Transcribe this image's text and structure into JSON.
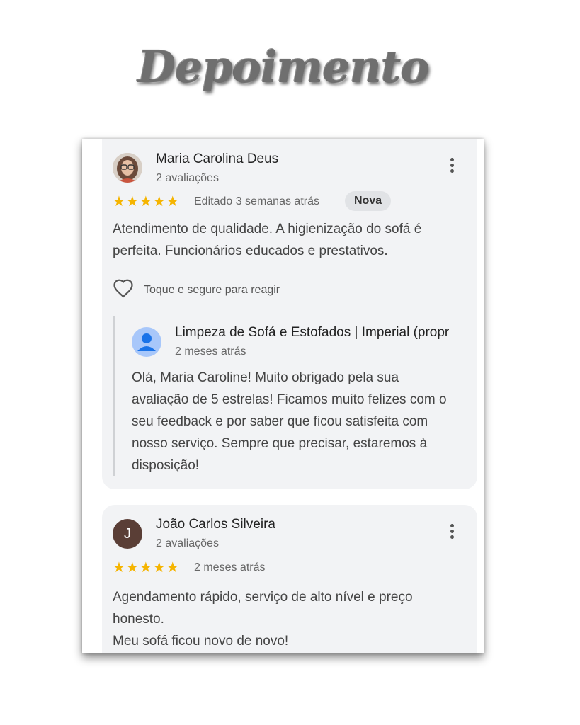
{
  "header": {
    "title": "Depoimento"
  },
  "reviews": [
    {
      "reviewer": "Maria Carolina Deus",
      "review_count": "2 avaliações",
      "stars": "★★★★★",
      "rating": 5,
      "date": "Editado 3 semanas atrás",
      "badge": "Nova",
      "text": "Atendimento de qualidade. A higienização do sofá é perfeita. Funcionários educados e prestativos.",
      "react_label": "Toque e segure para reagir",
      "reply": {
        "owner": "Limpeza de Sofá e Estofados | Imperial (propr",
        "date": "2 meses atrás",
        "text": "Olá, Maria Caroline! Muito obrigado pela sua avaliação de 5 estrelas! Ficamos muito felizes com o seu feedback e por saber que ficou satisfeita com nosso serviço. Sempre que precisar, estaremos à disposição!"
      }
    },
    {
      "reviewer": "João Carlos Silveira",
      "avatar_letter": "J",
      "review_count": "2 avaliações",
      "stars": "★★★★★",
      "rating": 5,
      "date": "2 meses atrás",
      "text_line1": "Agendamento rápido, serviço de alto nível e preço honesto.",
      "text_line2": "Meu sofá ficou novo de novo!"
    }
  ],
  "colors": {
    "star": "#f5b400",
    "card_bg": "#f2f3f5",
    "owner_avatar": "#a8c7fa",
    "letter_avatar": "#5a3e36"
  },
  "icons": [
    "more-vert-icon",
    "heart-outline-icon",
    "person-icon",
    "star-icon"
  ]
}
